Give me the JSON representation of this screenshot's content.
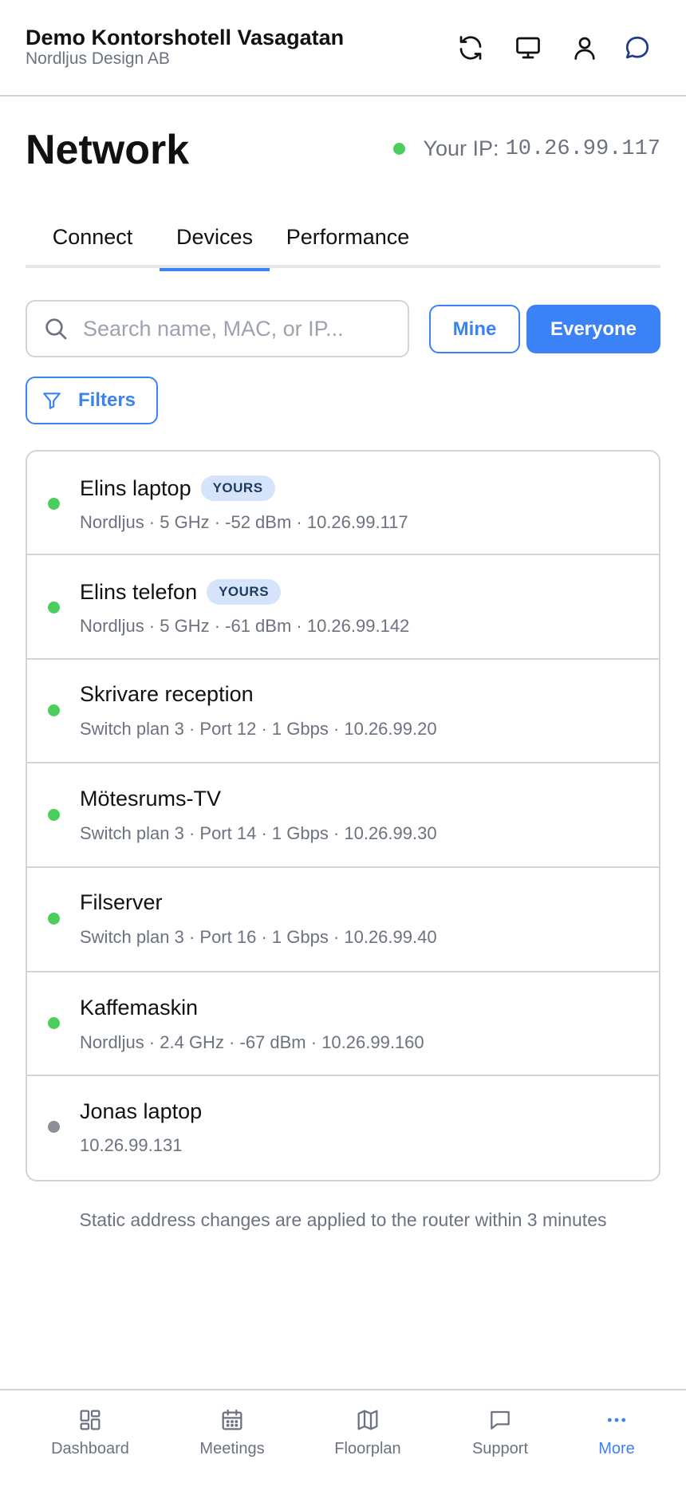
{
  "header": {
    "title": "Demo Kontorshotell Vasagatan",
    "subtitle": "Nordljus Design AB",
    "icons": [
      "refresh-icon",
      "monitor-icon",
      "user-icon",
      "chat-icon"
    ]
  },
  "page": {
    "title": "Network",
    "ip_label": "Your IP:",
    "ip_value": "10.26.99.117",
    "ip_status_color": "#4cce5c"
  },
  "tabs": [
    {
      "label": "Connect",
      "active": false
    },
    {
      "label": "Devices",
      "active": true
    },
    {
      "label": "Performance",
      "active": false
    }
  ],
  "search": {
    "placeholder": "Search name, MAC, or IP..."
  },
  "scope": {
    "mine_label": "Mine",
    "everyone_label": "Everyone",
    "selected": "Everyone"
  },
  "filters": {
    "label": "Filters"
  },
  "devices": [
    {
      "name": "Elins laptop",
      "badge": "YOURS",
      "meta": "Nordljus · 5 GHz · -52 dBm · 10.26.99.117",
      "status": "online"
    },
    {
      "name": "Elins telefon",
      "badge": "YOURS",
      "meta": "Nordljus · 5 GHz · -61 dBm · 10.26.99.142",
      "status": "online"
    },
    {
      "name": "Skrivare reception",
      "badge": "",
      "meta": "Switch plan 3 · Port 12 · 1 Gbps · 10.26.99.20",
      "status": "online"
    },
    {
      "name": "Mötesrums-TV",
      "badge": "",
      "meta": "Switch plan 3 · Port 14 · 1 Gbps · 10.26.99.30",
      "status": "online"
    },
    {
      "name": "Filserver",
      "badge": "",
      "meta": "Switch plan 3 · Port 16 · 1 Gbps · 10.26.99.40",
      "status": "online"
    },
    {
      "name": "Kaffemaskin",
      "badge": "",
      "meta": "Nordljus · 2.4 GHz · -67 dBm · 10.26.99.160",
      "status": "online"
    },
    {
      "name": "Jonas laptop",
      "badge": "",
      "meta": "10.26.99.131",
      "status": "offline"
    }
  ],
  "status_colors": {
    "online": "#4cce5c",
    "offline": "#8b8f97"
  },
  "footnote": "Static address changes are applied to the router within 3 minutes",
  "bottom_nav": [
    {
      "label": "Dashboard",
      "icon": "dashboard-icon",
      "active": false
    },
    {
      "label": "Meetings",
      "icon": "calendar-icon",
      "active": false
    },
    {
      "label": "Floorplan",
      "icon": "map-icon",
      "active": false
    },
    {
      "label": "Support",
      "icon": "support-chat-icon",
      "active": false
    },
    {
      "label": "More",
      "icon": "more-icon",
      "active": true
    }
  ],
  "accent_color": "#3b82f6"
}
